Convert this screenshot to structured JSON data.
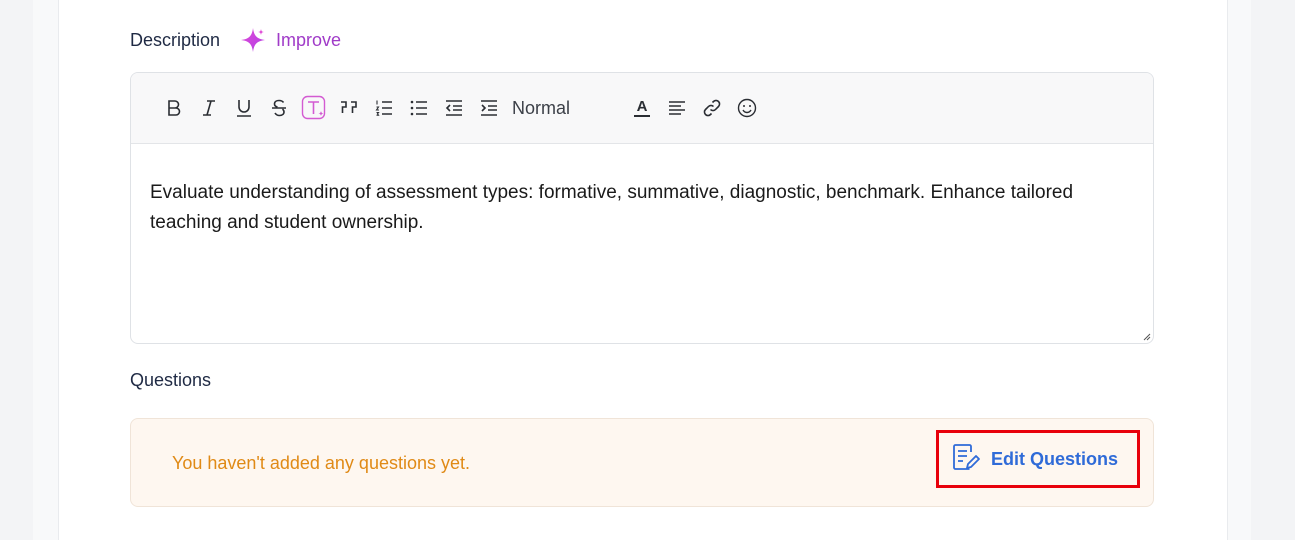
{
  "description": {
    "label": "Description",
    "improve_label": "Improve",
    "improve_icon": "sparkle-icon",
    "improve_color": "#a03bc8"
  },
  "toolbar": {
    "buttons": [
      {
        "name": "bold",
        "icon": "bold-icon",
        "glyph": "B"
      },
      {
        "name": "italic",
        "icon": "italic-icon",
        "glyph": "I"
      },
      {
        "name": "underline",
        "icon": "underline-icon",
        "glyph": "U"
      },
      {
        "name": "strikethrough",
        "icon": "strikethrough-icon",
        "glyph": "S"
      },
      {
        "name": "ai-text",
        "icon": "ai-text-icon",
        "glyph": "T"
      },
      {
        "name": "blockquote",
        "icon": "quote-icon",
        "glyph": "99"
      },
      {
        "name": "ordered-list",
        "icon": "ordered-list-icon"
      },
      {
        "name": "bullet-list",
        "icon": "bullet-list-icon"
      },
      {
        "name": "outdent",
        "icon": "outdent-icon"
      },
      {
        "name": "indent",
        "icon": "indent-icon"
      }
    ],
    "heading_select": "Normal",
    "text_color_glyph": "A",
    "extra_icons": [
      "text-color-icon",
      "align-icon",
      "link-icon",
      "emoji-icon"
    ]
  },
  "editor": {
    "content": "Evaluate understanding of assessment types: formative, summative, diagnostic, benchmark. Enhance tailored teaching and student ownership."
  },
  "questions": {
    "label": "Questions",
    "empty_message": "You haven't added any questions yet.",
    "edit_button_label": "Edit Questions",
    "edit_icon": "edit-document-icon",
    "empty_color": "#e08a16",
    "action_color": "#2f6bd8",
    "highlight_color": "#e8000b"
  }
}
